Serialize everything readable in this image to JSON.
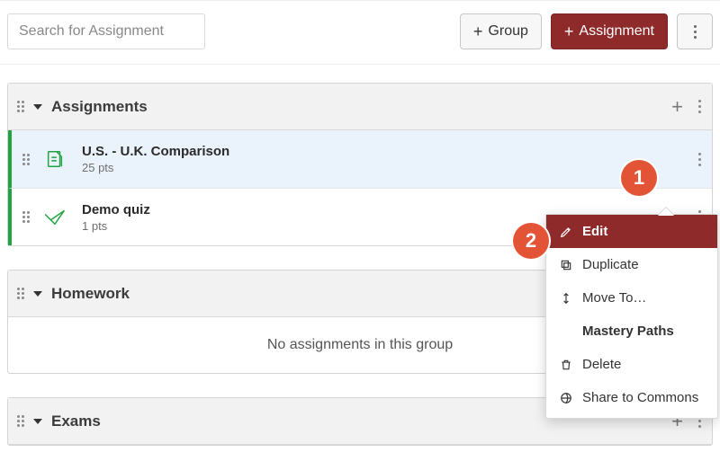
{
  "topbar": {
    "search_placeholder": "Search for Assignment",
    "group_button": "Group",
    "assignment_button": "Assignment"
  },
  "groups": [
    {
      "title": "Assignments",
      "items": [
        {
          "title": "U.S. - U.K. Comparison",
          "sub": "25 pts",
          "highlight": true,
          "icon": "assignment"
        },
        {
          "title": "Demo quiz",
          "sub": "1 pts",
          "highlight": false,
          "icon": "quiz"
        }
      ]
    },
    {
      "title": "Homework",
      "empty_text": "No assignments in this group",
      "items": []
    },
    {
      "title": "Exams",
      "items": []
    }
  ],
  "menu": {
    "items": [
      {
        "label": "Edit",
        "icon": "pencil",
        "active": true
      },
      {
        "label": "Duplicate",
        "icon": "copy"
      },
      {
        "label": "Move To…",
        "icon": "move"
      },
      {
        "label": "Mastery Paths",
        "icon": ""
      },
      {
        "label": "Delete",
        "icon": "trash"
      },
      {
        "label": "Share to Commons",
        "icon": "commons"
      }
    ]
  },
  "callouts": {
    "one": "1",
    "two": "2"
  }
}
